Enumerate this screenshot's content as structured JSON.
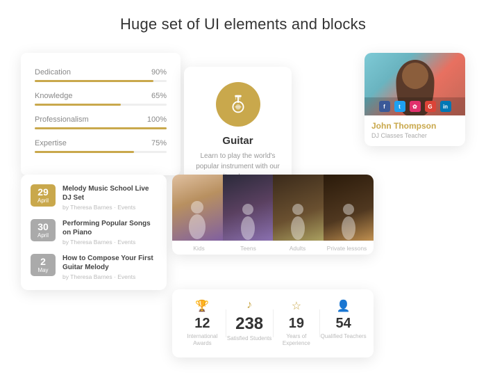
{
  "page": {
    "title": "Huge set of UI elements and blocks"
  },
  "progress_card": {
    "items": [
      {
        "label": "Dedication",
        "pct": 90,
        "pct_label": "90%"
      },
      {
        "label": "Knowledge",
        "pct": 65,
        "pct_label": "65%"
      },
      {
        "label": "Professionalism",
        "pct": 100,
        "pct_label": "100%"
      },
      {
        "label": "Expertise",
        "pct": 75,
        "pct_label": "75%"
      }
    ]
  },
  "guitar_card": {
    "title": "Guitar",
    "description": "Learn to play the world's popular instrument with our guitar classes."
  },
  "teacher_card": {
    "name": "John Thompson",
    "role": "DJ Classes Teacher",
    "social": [
      "f",
      "t",
      "G",
      "in"
    ]
  },
  "events_card": {
    "items": [
      {
        "day": "29",
        "month": "April",
        "title": "Melody Music School Live DJ Set",
        "meta": "by Theresa Barnes · Events",
        "style": "gold"
      },
      {
        "day": "30",
        "month": "April",
        "title": "Performing Popular Songs on Piano",
        "meta": "by Theresa Barnes · Events",
        "style": "gray"
      },
      {
        "day": "2",
        "month": "May",
        "title": "How to Compose Your First Guitar Melody",
        "meta": "by Theresa Barnes · Events",
        "style": "gray"
      }
    ]
  },
  "photos_strip": {
    "categories": [
      {
        "label": "Kids"
      },
      {
        "label": "Teens"
      },
      {
        "label": "Adults"
      },
      {
        "label": "Private lessons"
      }
    ]
  },
  "stats_card": {
    "items": [
      {
        "icon": "🏆",
        "number": "12",
        "label": "International Awards"
      },
      {
        "icon": "♪",
        "number": "238",
        "label": "Satisfied Students",
        "large": true
      },
      {
        "icon": "☆",
        "number": "19",
        "label": "Years of Experience"
      },
      {
        "icon": "👤",
        "number": "54",
        "label": "Qualified Teachers"
      }
    ]
  }
}
